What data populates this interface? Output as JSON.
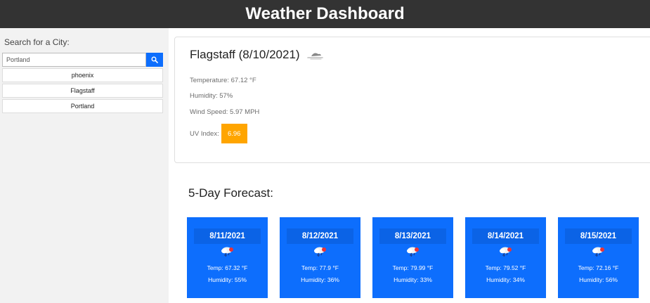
{
  "header": {
    "title": "Weather Dashboard"
  },
  "sidebar": {
    "search_label": "Search for a City:",
    "search_value": "Portland",
    "search_icon": "search-icon",
    "history": [
      "phoenix",
      "Flagstaff",
      "Portland"
    ]
  },
  "current": {
    "title": "Flagstaff (8/10/2021)",
    "icon": "mist-icon",
    "temperature": "Temperature: 67.12 °F",
    "humidity": "Humidity: 57%",
    "wind": "Wind Speed: 5.97 MPH",
    "uv_label": "UV Index:",
    "uv_value": "6.96",
    "uv_color": "#ffa500"
  },
  "forecast": {
    "title": "5-Day Forecast:",
    "days": [
      {
        "date": "8/11/2021",
        "icon": "thunderstorm-icon",
        "temp": "Temp: 67.32 °F",
        "humidity": "Humidity: 55%"
      },
      {
        "date": "8/12/2021",
        "icon": "thunderstorm-icon",
        "temp": "Temp: 77.9 °F",
        "humidity": "Humidity: 36%"
      },
      {
        "date": "8/13/2021",
        "icon": "thunderstorm-icon",
        "temp": "Temp: 79.99 °F",
        "humidity": "Humidity: 33%"
      },
      {
        "date": "8/14/2021",
        "icon": "thunderstorm-icon",
        "temp": "Temp: 79.52 °F",
        "humidity": "Humidity: 34%"
      },
      {
        "date": "8/15/2021",
        "icon": "thunderstorm-icon",
        "temp": "Temp: 72.16 °F",
        "humidity": "Humidity: 56%"
      }
    ]
  },
  "colors": {
    "header_bg": "#333333",
    "accent": "#0d6efd",
    "uv_moderate": "#ffa500"
  }
}
